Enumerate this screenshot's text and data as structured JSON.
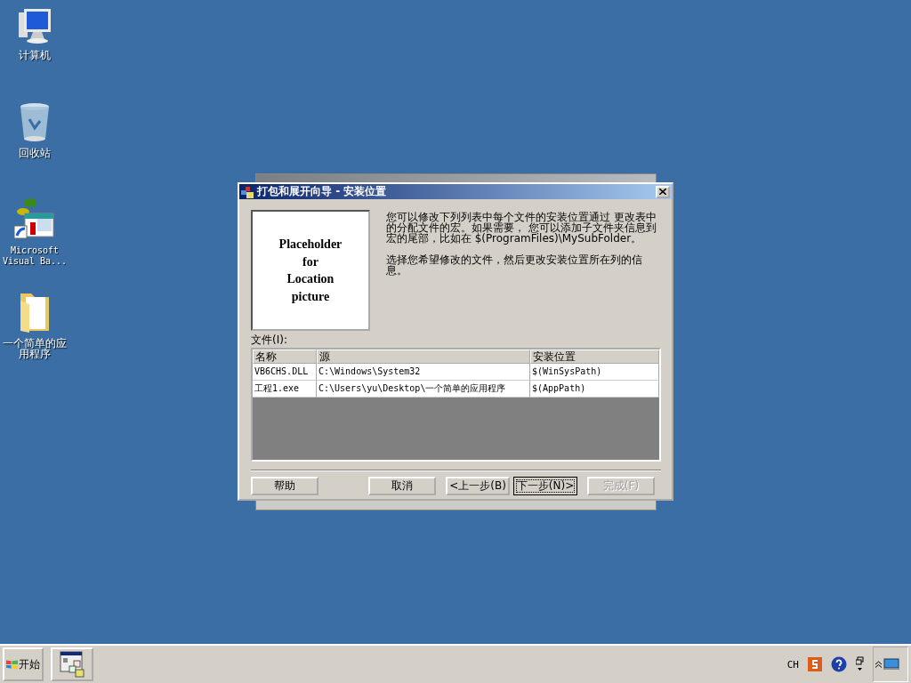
{
  "desktop_icons": [
    {
      "kind": "computer",
      "label": "计算机"
    },
    {
      "kind": "recycle",
      "label": "回收站"
    },
    {
      "kind": "shortcut",
      "label": "Microsoft Visual Ba..."
    },
    {
      "kind": "folder",
      "label": "一个简单的应用程序"
    }
  ],
  "dialog": {
    "title": "打包和展开向导 - 安装位置",
    "picture_lines": [
      "Placeholder",
      "for",
      "Location",
      "picture"
    ],
    "paragraphs": [
      "您可以修改下列列表中每个文件的安装位置通过 更改表中的分配文件的宏。如果需要， 您可以添加子文件夹信息到宏的尾部，比如在 $(ProgramFiles)\\MySubFolder。",
      "选择您希望修改的文件，然后更改安装位置所在列的信息。"
    ],
    "list_label": "文件(I):",
    "columns": [
      "名称",
      "源",
      "安装位置"
    ],
    "rows": [
      [
        "VB6CHS.DLL",
        "C:\\Windows\\System32",
        "$(WinSysPath)"
      ],
      [
        "工程1.exe",
        "C:\\Users\\yu\\Desktop\\一个简单的应用程序",
        "$(AppPath)"
      ]
    ],
    "buttons": [
      {
        "label": "帮助",
        "disabled": false,
        "focused": false
      },
      {
        "label": "取消",
        "disabled": false,
        "focused": false
      },
      {
        "label": "<上一步(B)",
        "disabled": false,
        "focused": false
      },
      {
        "label": "下一步(N)>",
        "disabled": false,
        "focused": true
      },
      {
        "label": "完成(F)",
        "disabled": true,
        "focused": false
      }
    ]
  },
  "taskbar": {
    "start": "开始",
    "tray": {
      "language": "CH"
    }
  }
}
